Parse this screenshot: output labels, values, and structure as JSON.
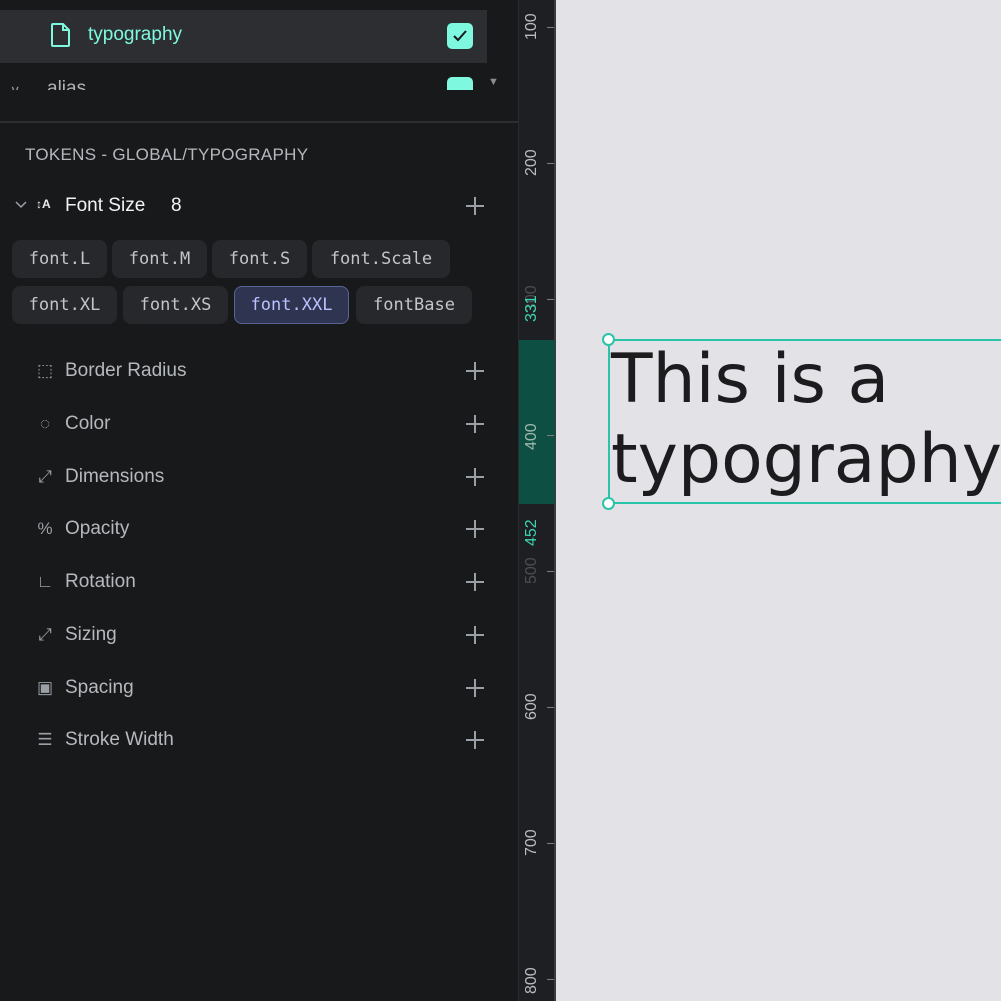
{
  "token_sets": {
    "active_set": "typography",
    "collapsed_set": "alias"
  },
  "panel": {
    "section_title": "TOKENS - GLOBAL/TYPOGRAPHY",
    "expanded_group": {
      "label": "Font Size",
      "count": "8",
      "icon": "font-size-icon",
      "tokens": [
        "font.L",
        "font.M",
        "font.S",
        "font.Scale",
        "font.XL",
        "font.XS",
        "font.XXL",
        "fontBase"
      ],
      "selected_token": "font.XXL"
    },
    "groups": [
      {
        "label": "Border Radius",
        "icon": "border-radius-icon",
        "glyph": "⬚"
      },
      {
        "label": "Color",
        "icon": "color-drop-icon",
        "glyph": "◌"
      },
      {
        "label": "Dimensions",
        "icon": "dimensions-icon",
        "glyph": "⤢"
      },
      {
        "label": "Opacity",
        "icon": "opacity-icon",
        "glyph": "%"
      },
      {
        "label": "Rotation",
        "icon": "rotation-icon",
        "glyph": "∟"
      },
      {
        "label": "Sizing",
        "icon": "sizing-icon",
        "glyph": "⤢"
      },
      {
        "label": "Spacing",
        "icon": "spacing-icon",
        "glyph": "▣"
      },
      {
        "label": "Stroke Width",
        "icon": "stroke-width-icon",
        "glyph": "☰"
      }
    ]
  },
  "ruler": {
    "ticks": [
      "100",
      "200",
      "300",
      "400",
      "500",
      "600",
      "700",
      "800"
    ],
    "selection_start": "331",
    "selection_end": "452"
  },
  "canvas": {
    "line1": "This is a",
    "line2": "typography"
  },
  "colors": {
    "accent": "#7ef9e0",
    "selection": "#2ac4a8",
    "panel_bg": "#18191b",
    "canvas_bg": "#e3e3e7"
  }
}
